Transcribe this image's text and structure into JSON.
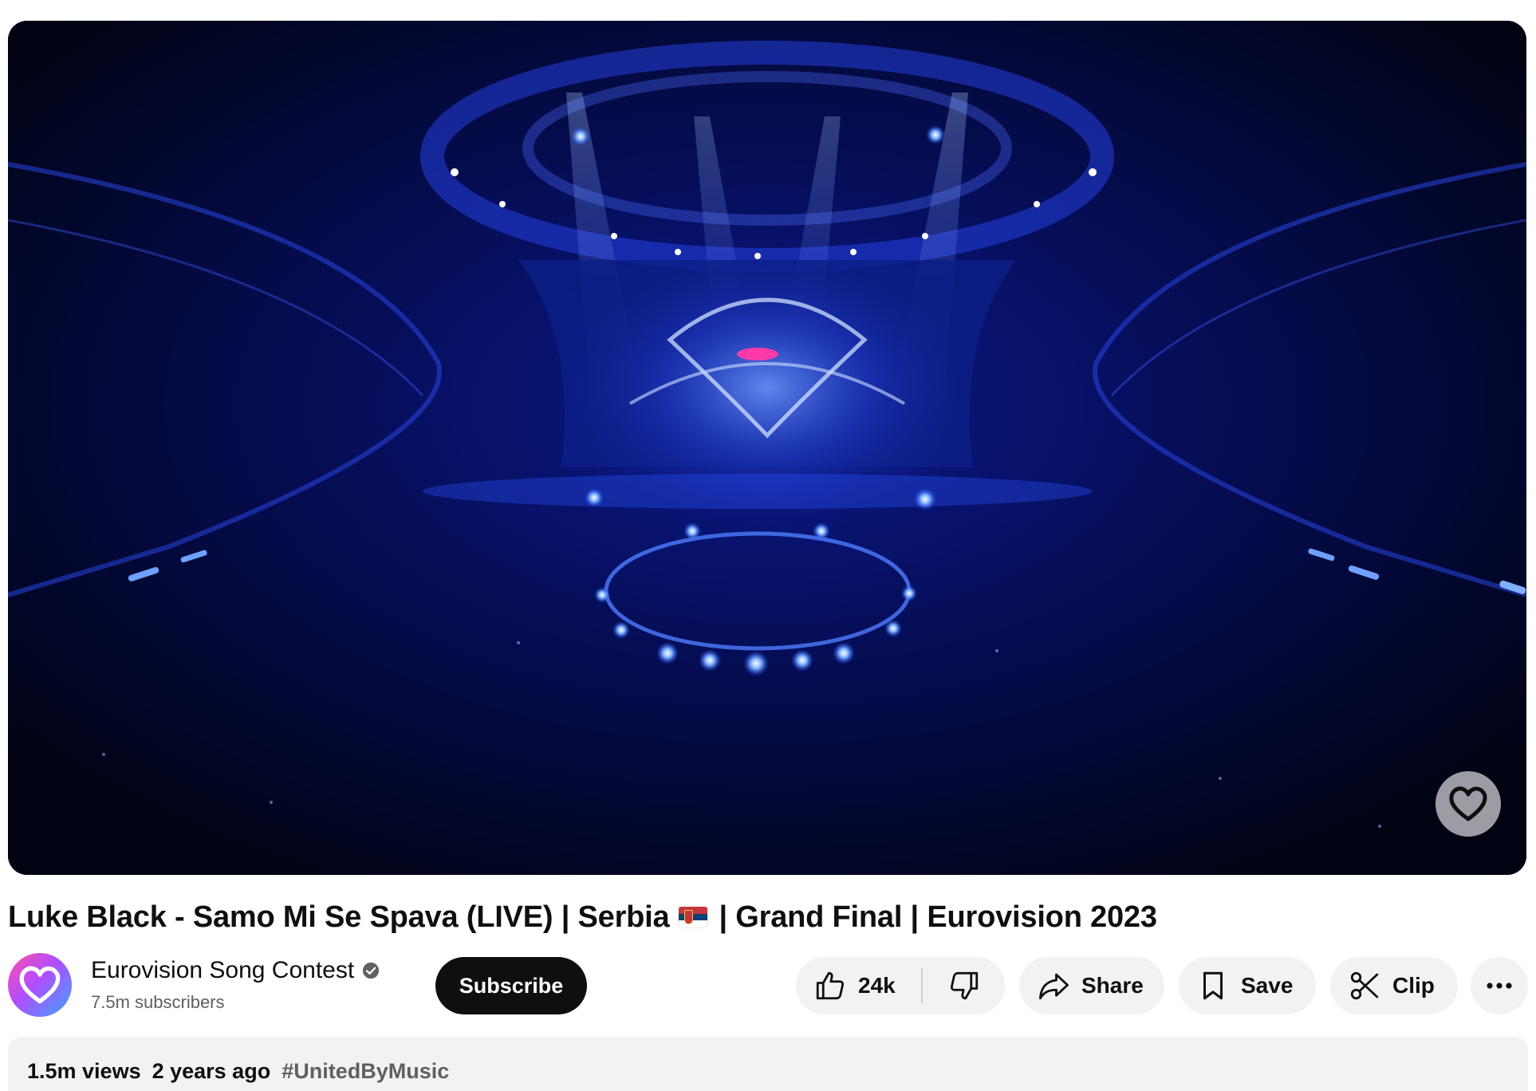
{
  "video": {
    "title_before_flag": "Luke Black - Samo Mi Se Spava (LIVE) | Serbia",
    "flag_icon": "serbia-flag-icon",
    "title_after_flag": "| Grand Final | Eurovision 2023",
    "watermark_icon": "eurovision-heart-icon"
  },
  "channel": {
    "name": "Eurovision Song Contest",
    "subscribers": "7.5m subscribers",
    "verified_icon": "verified-check-icon",
    "subscribe_label": "Subscribe"
  },
  "actions": {
    "like_count": "24k",
    "share_label": "Share",
    "save_label": "Save",
    "clip_label": "Clip"
  },
  "description": {
    "views": "1.5m views",
    "age": "2 years ago",
    "hashtag": "#UnitedByMusic"
  },
  "colors": {
    "accent_dark": "#0f0f0f",
    "pill_bg": "#f2f2f2",
    "stage_blue": "#1a4dff"
  }
}
